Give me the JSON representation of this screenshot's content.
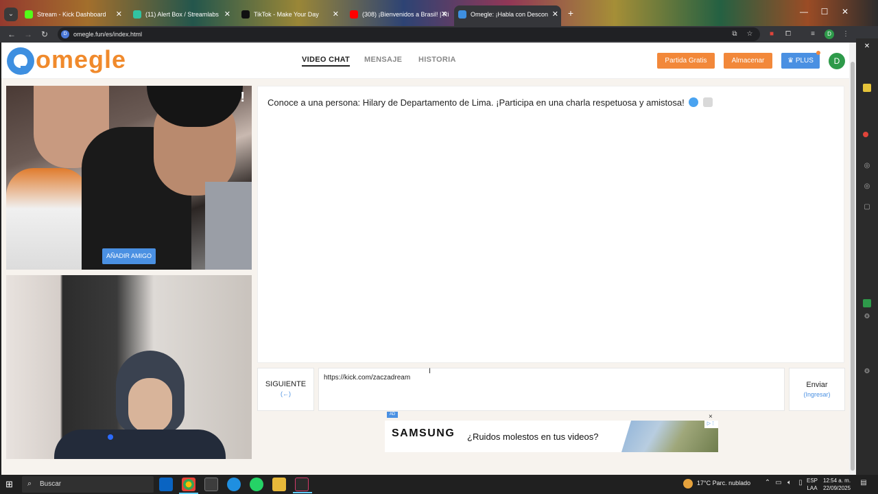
{
  "browser": {
    "tabs": [
      {
        "title": "Stream - Kick Dashboard",
        "favicon_color": "#53fc18"
      },
      {
        "title": "(11) Alert Box / Streamlabs",
        "favicon_color": "#31c3a2"
      },
      {
        "title": "TikTok - Make Your Day",
        "favicon_color": "#111111"
      },
      {
        "title": "(308) ¡Bienvenidos a Brasil! | Ri",
        "favicon_color": "#ff0000"
      },
      {
        "title": "Omegle: ¡Habla con Descon",
        "favicon_color": "#3e8fe0"
      }
    ],
    "url": "omegle.fun/es/index.html",
    "profile_initial": "D"
  },
  "site": {
    "logo_text": "omegle",
    "nav": [
      "VIDEO CHAT",
      "MENSAJE",
      "HISTORIA"
    ],
    "buttons": {
      "free_match": "Partida Gratis",
      "store": "Almacenar",
      "plus": "PLUS"
    },
    "user_initial": "D",
    "colors": {
      "accent_orange": "#f2883a",
      "accent_blue": "#4a90e2",
      "logo_blue": "#3e8fe0"
    }
  },
  "video": {
    "report_mark": "!",
    "add_friend": "AÑADIR AMIGO"
  },
  "chat": {
    "message": "Conoce a una persona: Hilary de Departamento de Lima. ¡Participa en una charla respetuosa y amistosa!",
    "next_label": "SIGUIENTE",
    "next_hint": "(←)",
    "input_value": "https://kick.com/zaczadream",
    "send_label": "Enviar",
    "send_hint": "(Ingresar)"
  },
  "ad": {
    "badge": "AD",
    "brand": "SAMSUNG",
    "copy": "¿Ruidos molestos en tus videos?",
    "close": "×"
  },
  "taskbar": {
    "search_placeholder": "Buscar",
    "weather": "17°C  Parc. nublado",
    "language_top": "ESP",
    "language_bottom": "LAA",
    "time": "12:54 a. m.",
    "date": "22/09/2025"
  }
}
